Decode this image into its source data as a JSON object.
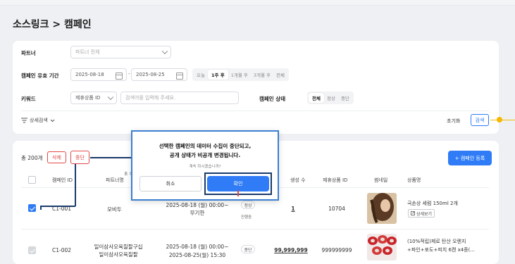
{
  "page": {
    "title": "소스링크 > 캠페인"
  },
  "filters": {
    "partner": {
      "label": "파트너",
      "placeholder": "파트너 전체"
    },
    "period": {
      "label": "캠페인 유효 기간",
      "start": "2025-08-18",
      "end": "2025-08-25",
      "range_sep": "-",
      "quick": [
        "오늘",
        "1주 후",
        "1개월 후",
        "3개월 후",
        "전체"
      ],
      "quick_selected": "1주 후"
    },
    "keyword": {
      "label": "키워드",
      "field": "제휴상품 ID",
      "placeholder": "검색어를 입력해 주세요."
    },
    "status": {
      "label": "캠페인 상태",
      "options": [
        "전체",
        "정상",
        "중단"
      ],
      "selected": "전체"
    },
    "detail_search": "상세검색",
    "reset": "초기화",
    "search": "검색"
  },
  "list": {
    "total": "총 200개",
    "delete": "삭제",
    "stop": "중단",
    "register": "+ 캠페인 등록",
    "headers": [
      "캠페인 ID",
      "파트너명",
      "",
      "생성 수",
      "제휴상품 ID",
      "썸네일",
      "상품명"
    ],
    "rows": [
      {
        "id": "C1-001",
        "partner": "모비두",
        "period1": "2025-08-18 (월) 00:00~",
        "period2": "무기한",
        "status": "정상",
        "status_sub": "진행중",
        "count": "1",
        "product_id": "10704",
        "name1": "극손상 세럼 150ml 2개",
        "name2": "",
        "detail": "상세보기",
        "checked": true
      },
      {
        "id": "C1-002",
        "partner": "일이삼사오육칠팔구십",
        "partner2": "일이삼사오육칠팔",
        "period1": "2025-08-18 (월) 00:00~",
        "period2": "2025-08-25(월) 15:30",
        "status": "중단",
        "status_sub": "",
        "count": "99,999,999",
        "product_id": "999999999",
        "name1": "(10%적립)제로 탄산 오렌지",
        "name2": "+파인+포도+피치 6캔 x4종(...",
        "detail": "",
        "checked": false
      }
    ]
  },
  "modal": {
    "line1": "선택한 캠페인의 데이터 수집이 중단되고,",
    "line2": "공개 상태가 비공개 변경됩니다.",
    "sub": "계속 하시겠습니까?",
    "cancel": "취소",
    "confirm": "확인"
  },
  "overlay": {
    "hidden_char": "초 수"
  },
  "colors": {
    "accent": "#2f7cf6",
    "danger": "#e04848",
    "annotation": "#1a3a6b",
    "marker": "#f5b800"
  }
}
